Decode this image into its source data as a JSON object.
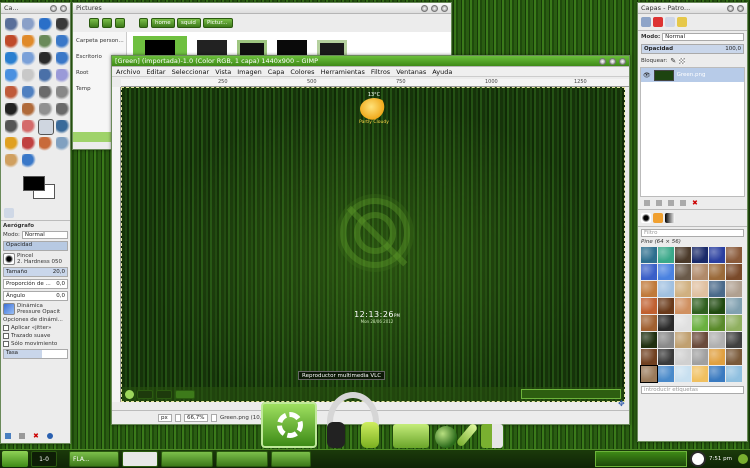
{
  "toolbox": {
    "title": "Ca...",
    "panel_title": "Aerógrafo",
    "mode_label": "Modo:",
    "mode_value": "Normal",
    "opacity_label": "Opacidad",
    "brush_label": "Pincel",
    "brush_value": "2. Hardness 050",
    "size_label": "Tamaño",
    "size_value": "20,0",
    "ratio_label": "Proporción de ...",
    "ratio_value": "0,0",
    "angle_label": "Ángulo",
    "angle_value": "0,0",
    "dynamics_label": "Dinámica",
    "dynamics_value": "Pressure Opacit",
    "dyn_options": "Opciones de dinámi...",
    "jitter": "Aplicar «jitter»",
    "smooth": "Trazado suave",
    "motion": "Sólo movimiento",
    "rate_label": "Tasa"
  },
  "filechooser": {
    "title": "Pictures",
    "path_buttons": [
      "home",
      "squid",
      "Pictur..."
    ],
    "places": [
      "Carpeta person...",
      "Escritorio",
      "Root",
      "Temp"
    ]
  },
  "gimp": {
    "title": "[Green] (importada)-1.0 (Color RGB, 1 capa) 1440x900 – GIMP",
    "menu": [
      "Archivo",
      "Editar",
      "Seleccionar",
      "Vista",
      "Imagen",
      "Capa",
      "Colores",
      "Herramientas",
      "Filtros",
      "Ventanas",
      "Ayuda"
    ],
    "ruler_marks": [
      "250",
      "500",
      "750",
      "1000",
      "1250"
    ],
    "weather_temp": "13°C",
    "weather_text": "Partly Cloudy",
    "clock": "12:13:26",
    "clock_sec": "PM",
    "date": "Mon 28/06 2012",
    "status_unit": "px",
    "zoom": "66,7%",
    "status_text": "Green.png (10,9 ...",
    "tooltip": "Reproductor multimedia VLC"
  },
  "layers": {
    "title": "Capas - Patro...",
    "mode_label": "Modo:",
    "mode_value": "Normal",
    "opacity_label": "Opacidad",
    "opacity_value": "100,0",
    "lock_label": "Bloquear:",
    "layer_name": "Green.png",
    "filter_placeholder": "Filtro",
    "pattern_name": "Pine (64 × 56)",
    "tag_placeholder": "introducir etiquetas"
  },
  "taskbar": {
    "workspace": "1-0",
    "items": [
      "FLA...",
      "",
      "",
      ""
    ],
    "clock": "7:51 pm"
  },
  "colors": {
    "accent": "#5aa52a",
    "titlebar": "#e4e4e4",
    "canvas_dark": "#14330a"
  }
}
